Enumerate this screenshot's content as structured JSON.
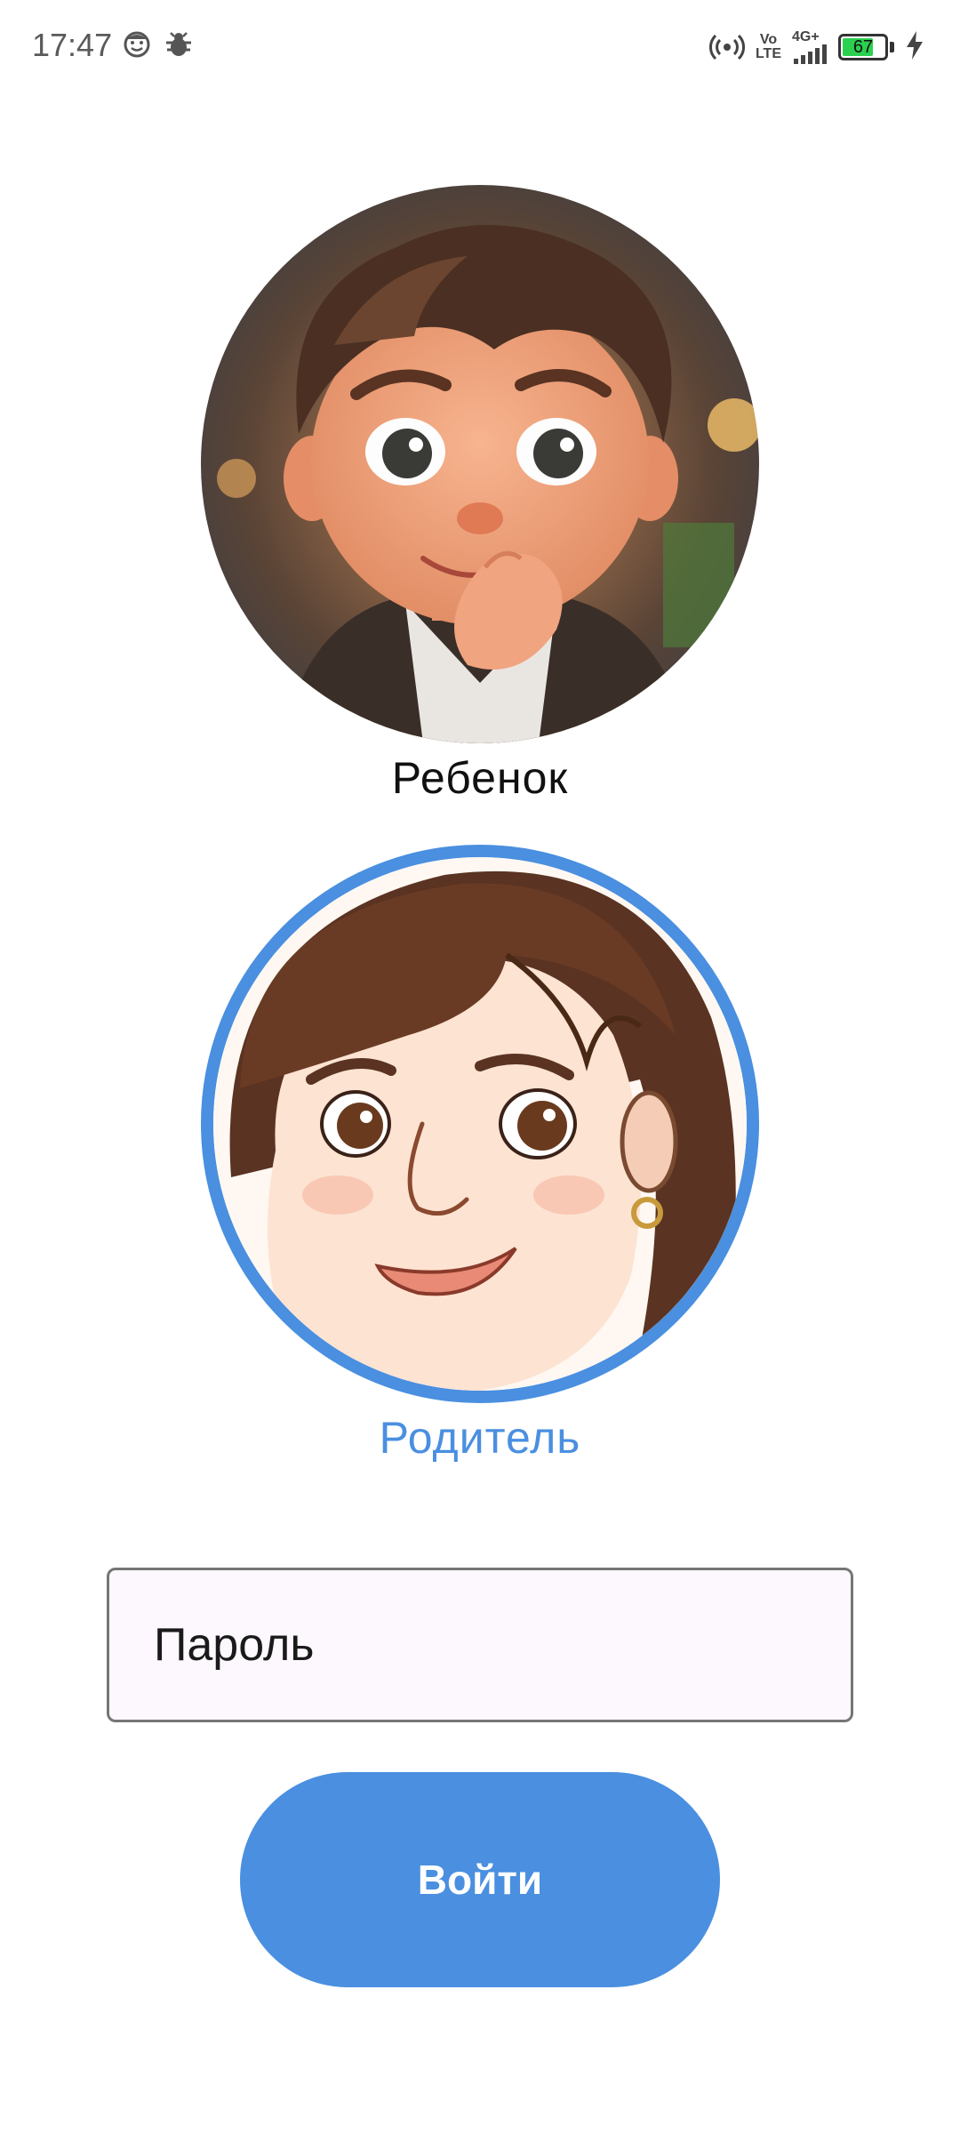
{
  "status_bar": {
    "time": "17:47",
    "network_labels": {
      "volte_top": "Vo",
      "volte_bottom": "LTE",
      "gen": "4G+"
    },
    "battery_level": "67",
    "icons": [
      "face-icon",
      "bug-icon",
      "hotspot-icon",
      "volte-icon",
      "signal-icon",
      "battery-icon",
      "charging-icon"
    ]
  },
  "profiles": [
    {
      "label": "Ребенок",
      "avatar": "boy-avatar",
      "selected": false
    },
    {
      "label": "Родитель",
      "avatar": "woman-avatar",
      "selected": true
    }
  ],
  "form": {
    "password_placeholder": "Пароль",
    "password_value": "",
    "login_label": "Войти"
  },
  "colors": {
    "accent": "#4a8fe0",
    "field_background": "#fcf8fd",
    "field_border": "#767676"
  }
}
